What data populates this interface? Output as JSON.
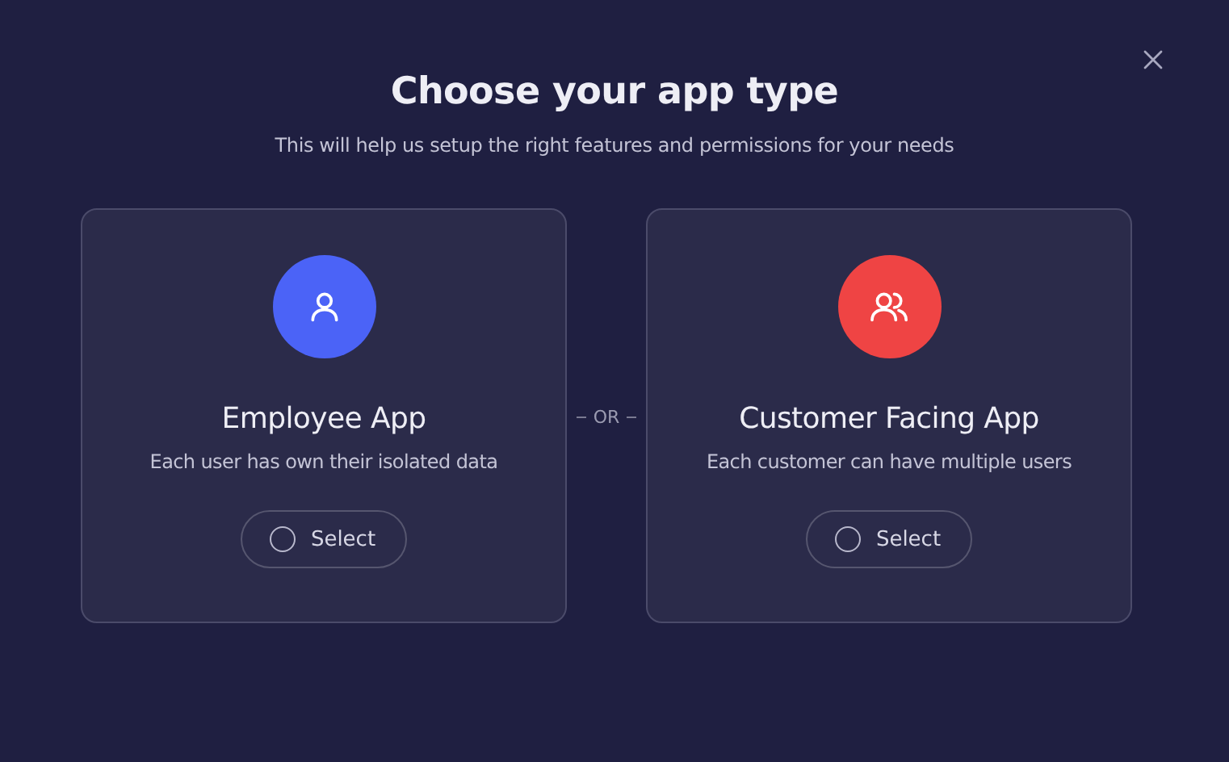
{
  "dialog": {
    "title": "Choose your app type",
    "subtitle": "This will help us setup the right features and permissions for your needs"
  },
  "options": [
    {
      "kind": "single",
      "color": "#4b63f7",
      "title": "Employee App",
      "description": "Each user has own their isolated data",
      "button": "Select",
      "selected": false
    },
    {
      "kind": "multiple",
      "color": "#ef4444",
      "title": "Customer Facing App",
      "description": "Each customer can have multiple users",
      "button": "Select",
      "selected": false
    }
  ],
  "separator": "OR"
}
